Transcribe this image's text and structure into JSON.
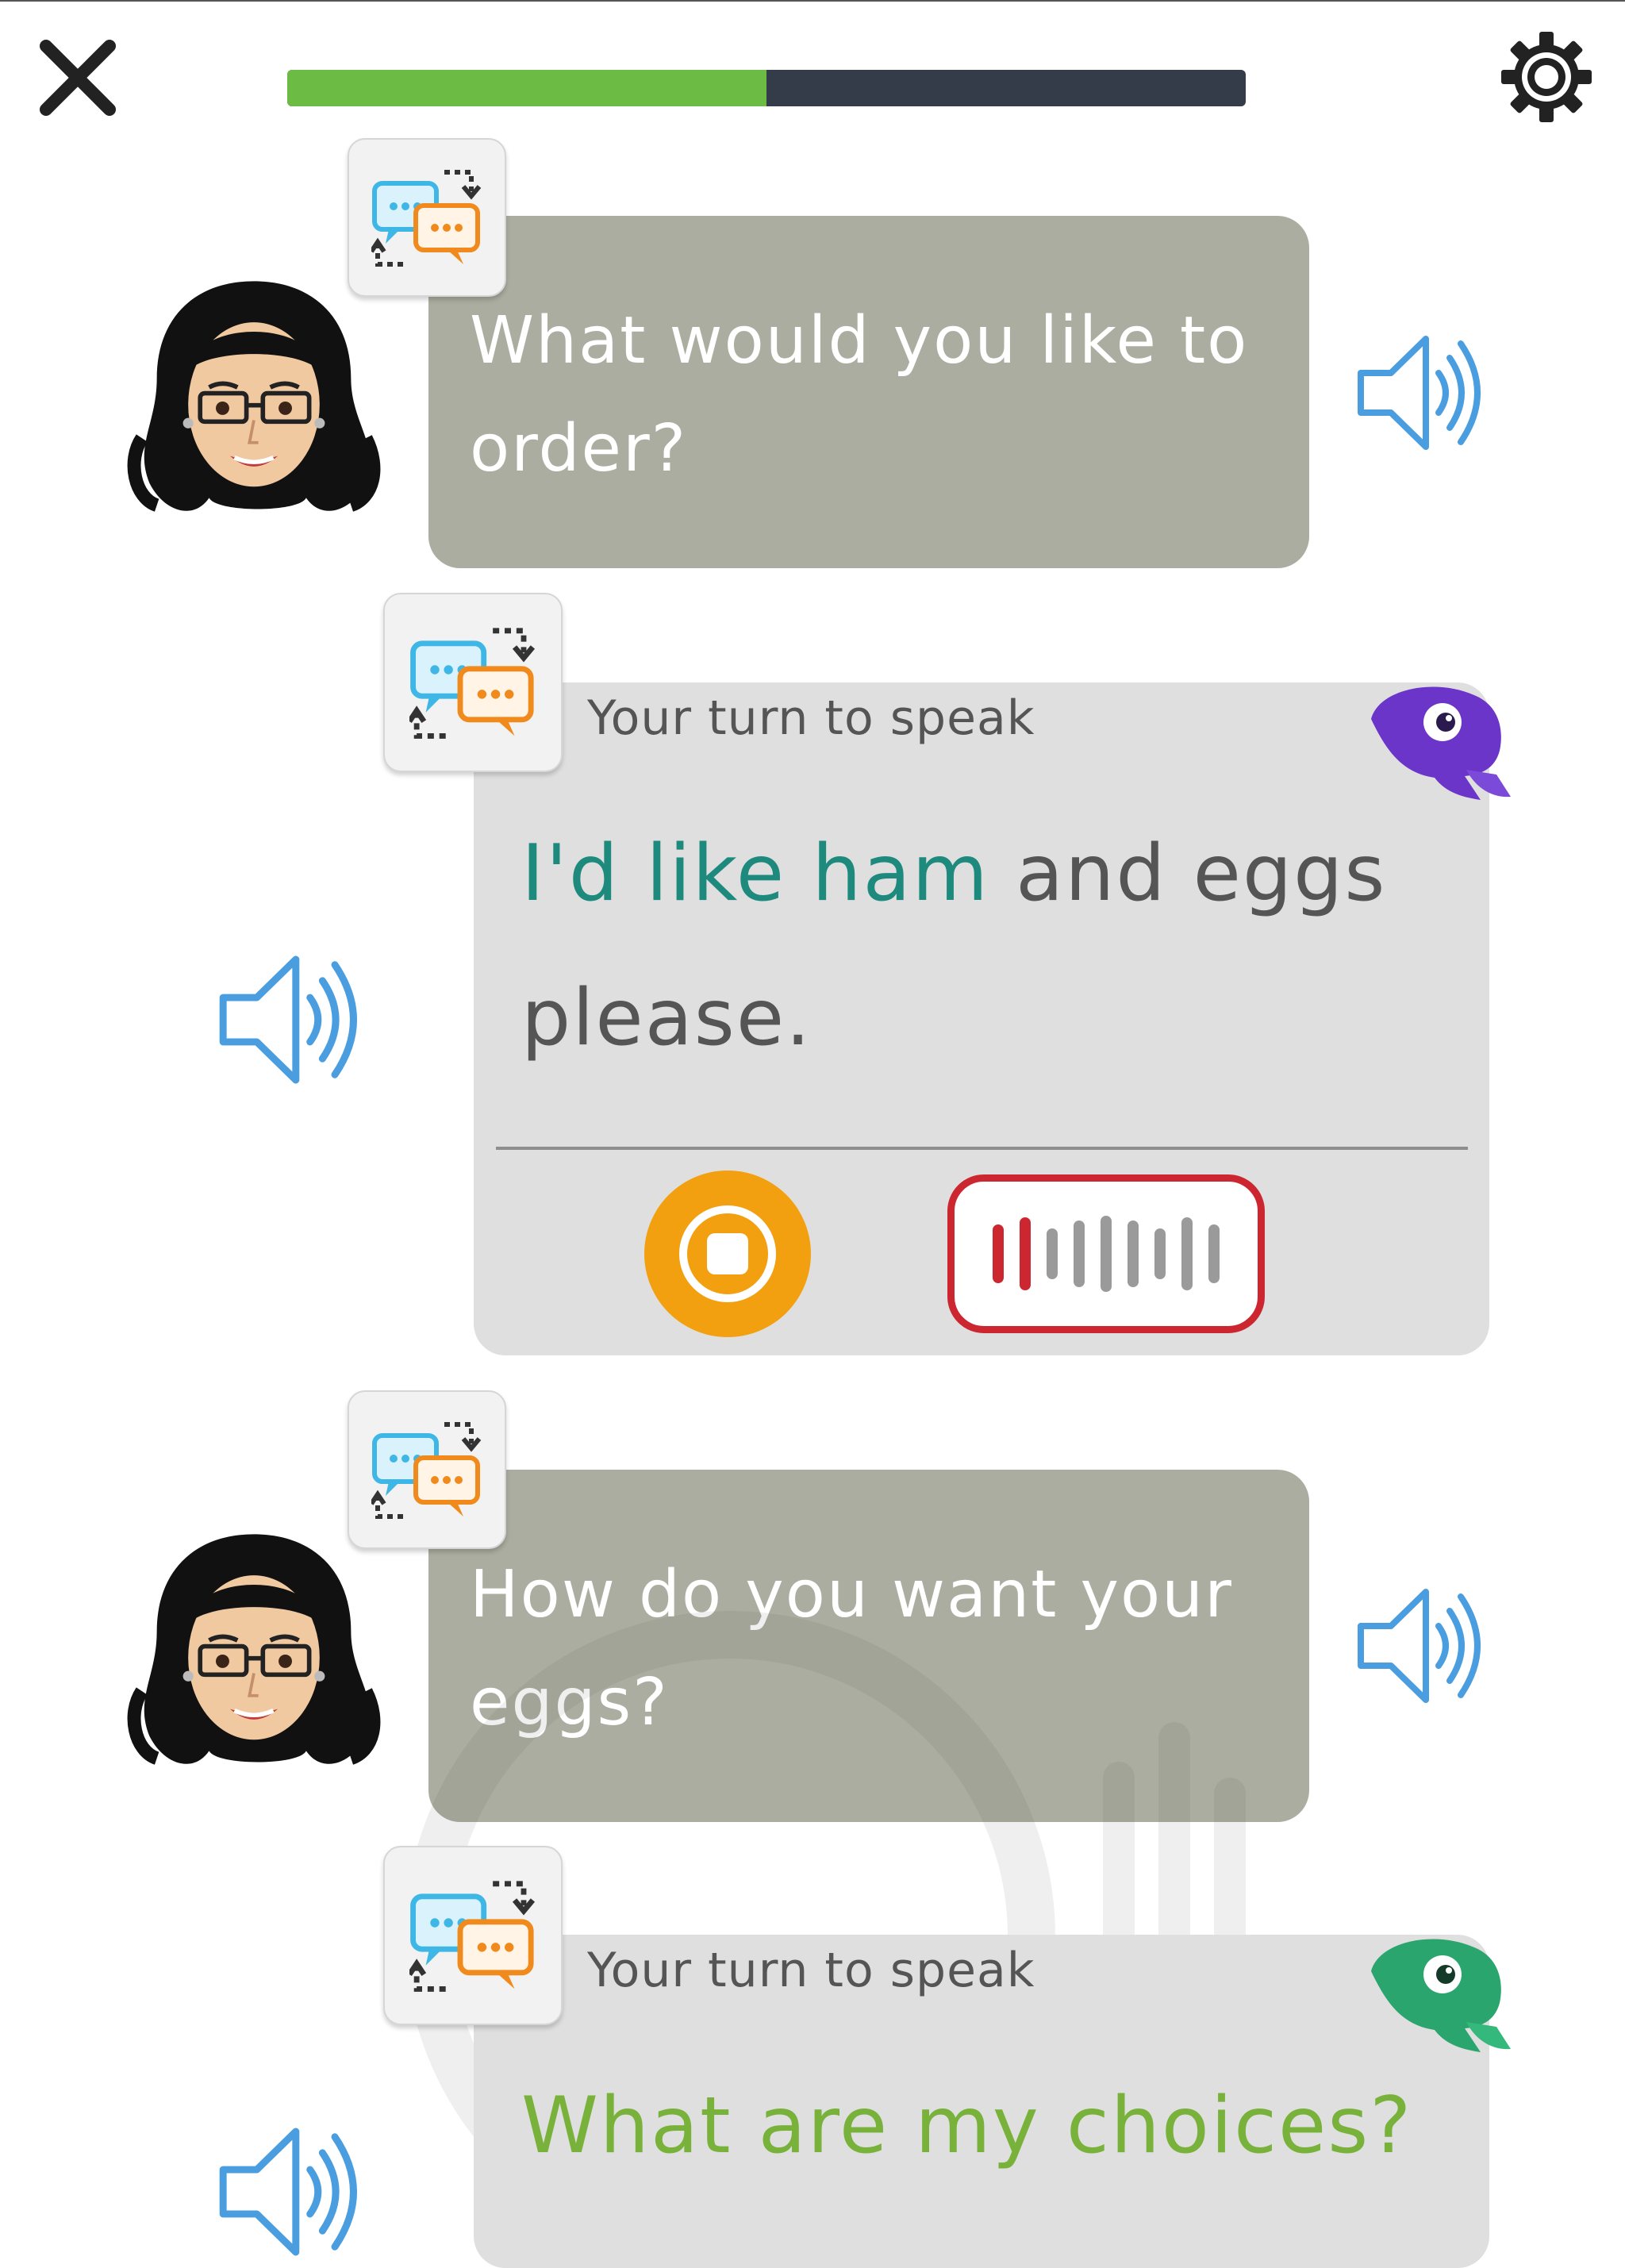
{
  "header": {
    "progress_fraction": 0.5,
    "progress_fill_color": "#6cbb45",
    "progress_track_color": "#343c49",
    "close_icon": "close-icon",
    "settings_icon": "gear-icon"
  },
  "conversation": [
    {
      "role": "teacher",
      "text": "What would you like to order?"
    },
    {
      "role": "learner",
      "label": "Your turn to speak",
      "highlight": "I'd like ham",
      "rest": " and eggs please."
    },
    {
      "role": "teacher",
      "text": "How do you want your eggs?"
    },
    {
      "role": "learner",
      "label": "Your turn to speak",
      "highlight": "What are my choices?",
      "rest": ""
    }
  ],
  "colors": {
    "teacher_bubble": "#abada0",
    "learner_card": "#dfdfdf",
    "speaker_blue": "#4a9ee0",
    "stop_orange": "#f3a010",
    "record_red": "#cc2630",
    "teal_highlight": "#1e8a7d",
    "green_highlight": "#78b23a",
    "parrot_purple": "#6a35c8",
    "parrot_green": "#2aa56e"
  }
}
